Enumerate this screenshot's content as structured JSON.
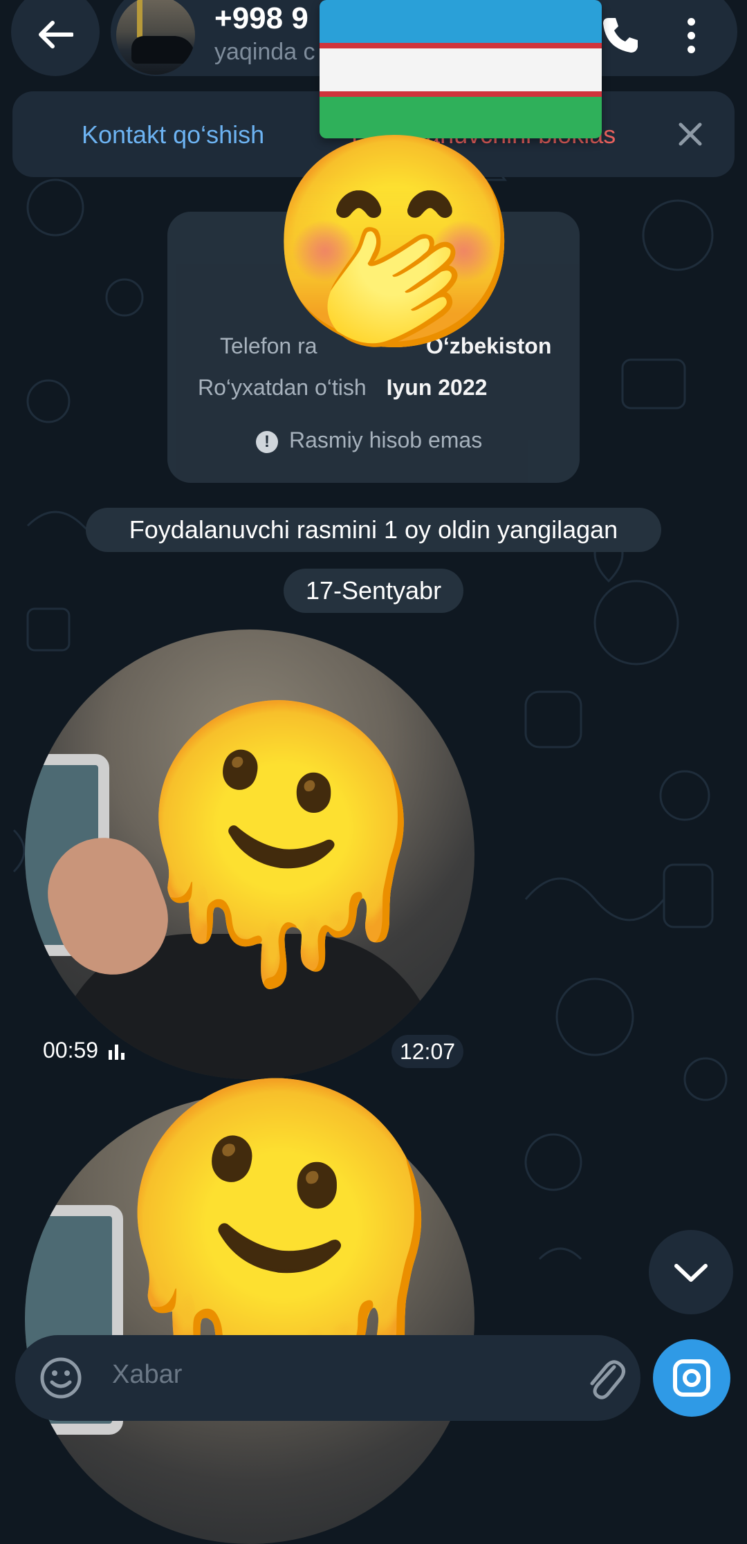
{
  "header": {
    "contact_name": "+998 9",
    "contact_status": "yaqinda c"
  },
  "action_bar": {
    "add_contact": "Kontakt qo‘shish",
    "block_user": "Foydalanuvchini bloklas"
  },
  "info_card": {
    "phone_label": "Telefon ra",
    "phone_value": "O‘zbekiston",
    "registration_label": "Ro‘yxatdan o‘tish",
    "registration_value": "Iyun 2022",
    "warning": "Rasmiy hisob emas"
  },
  "service_messages": {
    "photo_update": "Foydalanuvchi rasmini 1 oy oldin yangilagan",
    "date": "17-Sentyabr"
  },
  "messages": [
    {
      "type": "video_note",
      "duration": "00:59",
      "time": "12:07"
    },
    {
      "type": "video_note"
    }
  ],
  "input": {
    "placeholder": "Xabar"
  },
  "overlays": {
    "flag": "uzbekistan-flag",
    "face_emoji": "🤭",
    "melting_emoji": "🫠"
  },
  "colors": {
    "background": "#0f1821",
    "surface": "#1e2b39",
    "accent": "#2f9ae6",
    "link": "#6db3f2",
    "danger": "#e9615d"
  }
}
